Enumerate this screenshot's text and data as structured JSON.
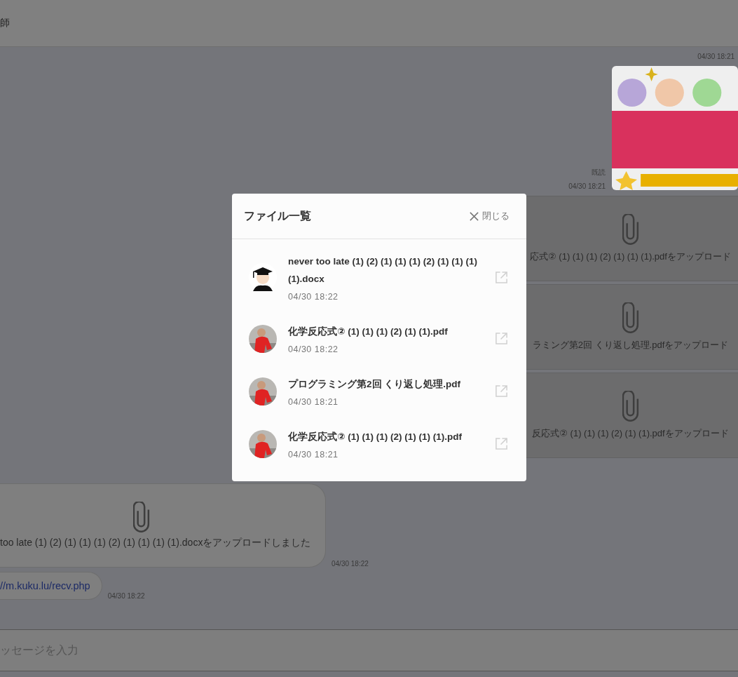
{
  "header": {
    "title": "師"
  },
  "right_messages": [
    {
      "kind": "picture",
      "read": "既読",
      "time": "04/30 18:21",
      "time_above": "04/30 18:21"
    },
    {
      "kind": "file",
      "text": "応式② (1) (1) (1) (2) (1) (1) (1).pdfをアップロード"
    },
    {
      "kind": "file",
      "text": "ラミング第2回 くり返し処理.pdfをアップロード"
    },
    {
      "kind": "file",
      "text": "反応式② (1) (1) (1) (2) (1) (1).pdfをアップロード"
    }
  ],
  "left_messages": [
    {
      "kind": "file",
      "text": "too late (1) (2) (1) (1) (1) (2) (1) (1) (1) (1).docxをアップロードしました",
      "time": "04/30 18:22"
    },
    {
      "kind": "link",
      "text": "//m.kuku.lu/recv.php",
      "time": "04/30 18:22"
    }
  ],
  "composer": {
    "placeholder": "ッセージを入力"
  },
  "modal": {
    "title": "ファイル一覧",
    "close": "閉じる",
    "files": [
      {
        "name": "never too late (1) (2) (1) (1) (1) (2) (1) (1) (1) (1).docx",
        "time": "04/30 18:22",
        "avatar": {
          "kind": "drawing"
        }
      },
      {
        "name": "化学反応式② (1) (1) (1) (2) (1) (1).pdf",
        "time": "04/30 18:22"
      },
      {
        "name": "プログラミング第2回 くり返し処理.pdf",
        "time": "04/30 18:21"
      },
      {
        "name": "化学反応式② (1) (1) (1) (2) (1) (1) (1).pdf",
        "time": "04/30 18:21"
      }
    ]
  }
}
